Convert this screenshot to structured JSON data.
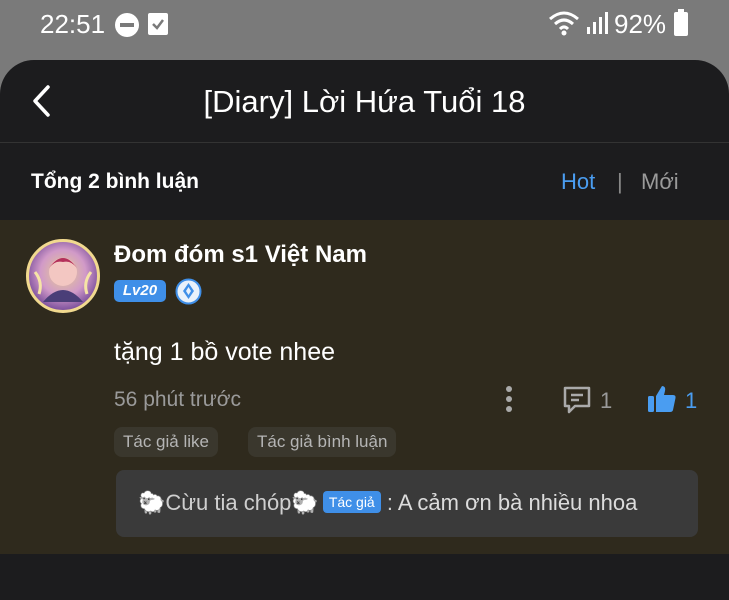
{
  "status_bar": {
    "time": "22:51",
    "battery": "92%"
  },
  "header": {
    "title": "[Diary] Lời Hứa Tuổi 18"
  },
  "summary": {
    "count_label": "Tổng 2 bình luận",
    "sort_hot": "Hot",
    "sort_divider": "|",
    "sort_new": "Mới"
  },
  "comment": {
    "user_name": "Đom đóm s1 Việt Nam",
    "level": "Lv20",
    "text": "tặng 1 bồ vote nhee",
    "time": "56 phút trước",
    "reply_count": "1",
    "like_count": "1",
    "tags": [
      "Tác giả like",
      "Tác giả bình luận"
    ],
    "reply": {
      "author_name": "🐑Cừu tia chóp🐑",
      "author_badge": "Tác giả",
      "separator": " : ",
      "text": "A cảm ơn bà nhiều nhoa"
    }
  },
  "colors": {
    "accent": "#4a9df1",
    "card_bg": "#2f2a1d",
    "sheet_bg": "#1c1c1e"
  }
}
